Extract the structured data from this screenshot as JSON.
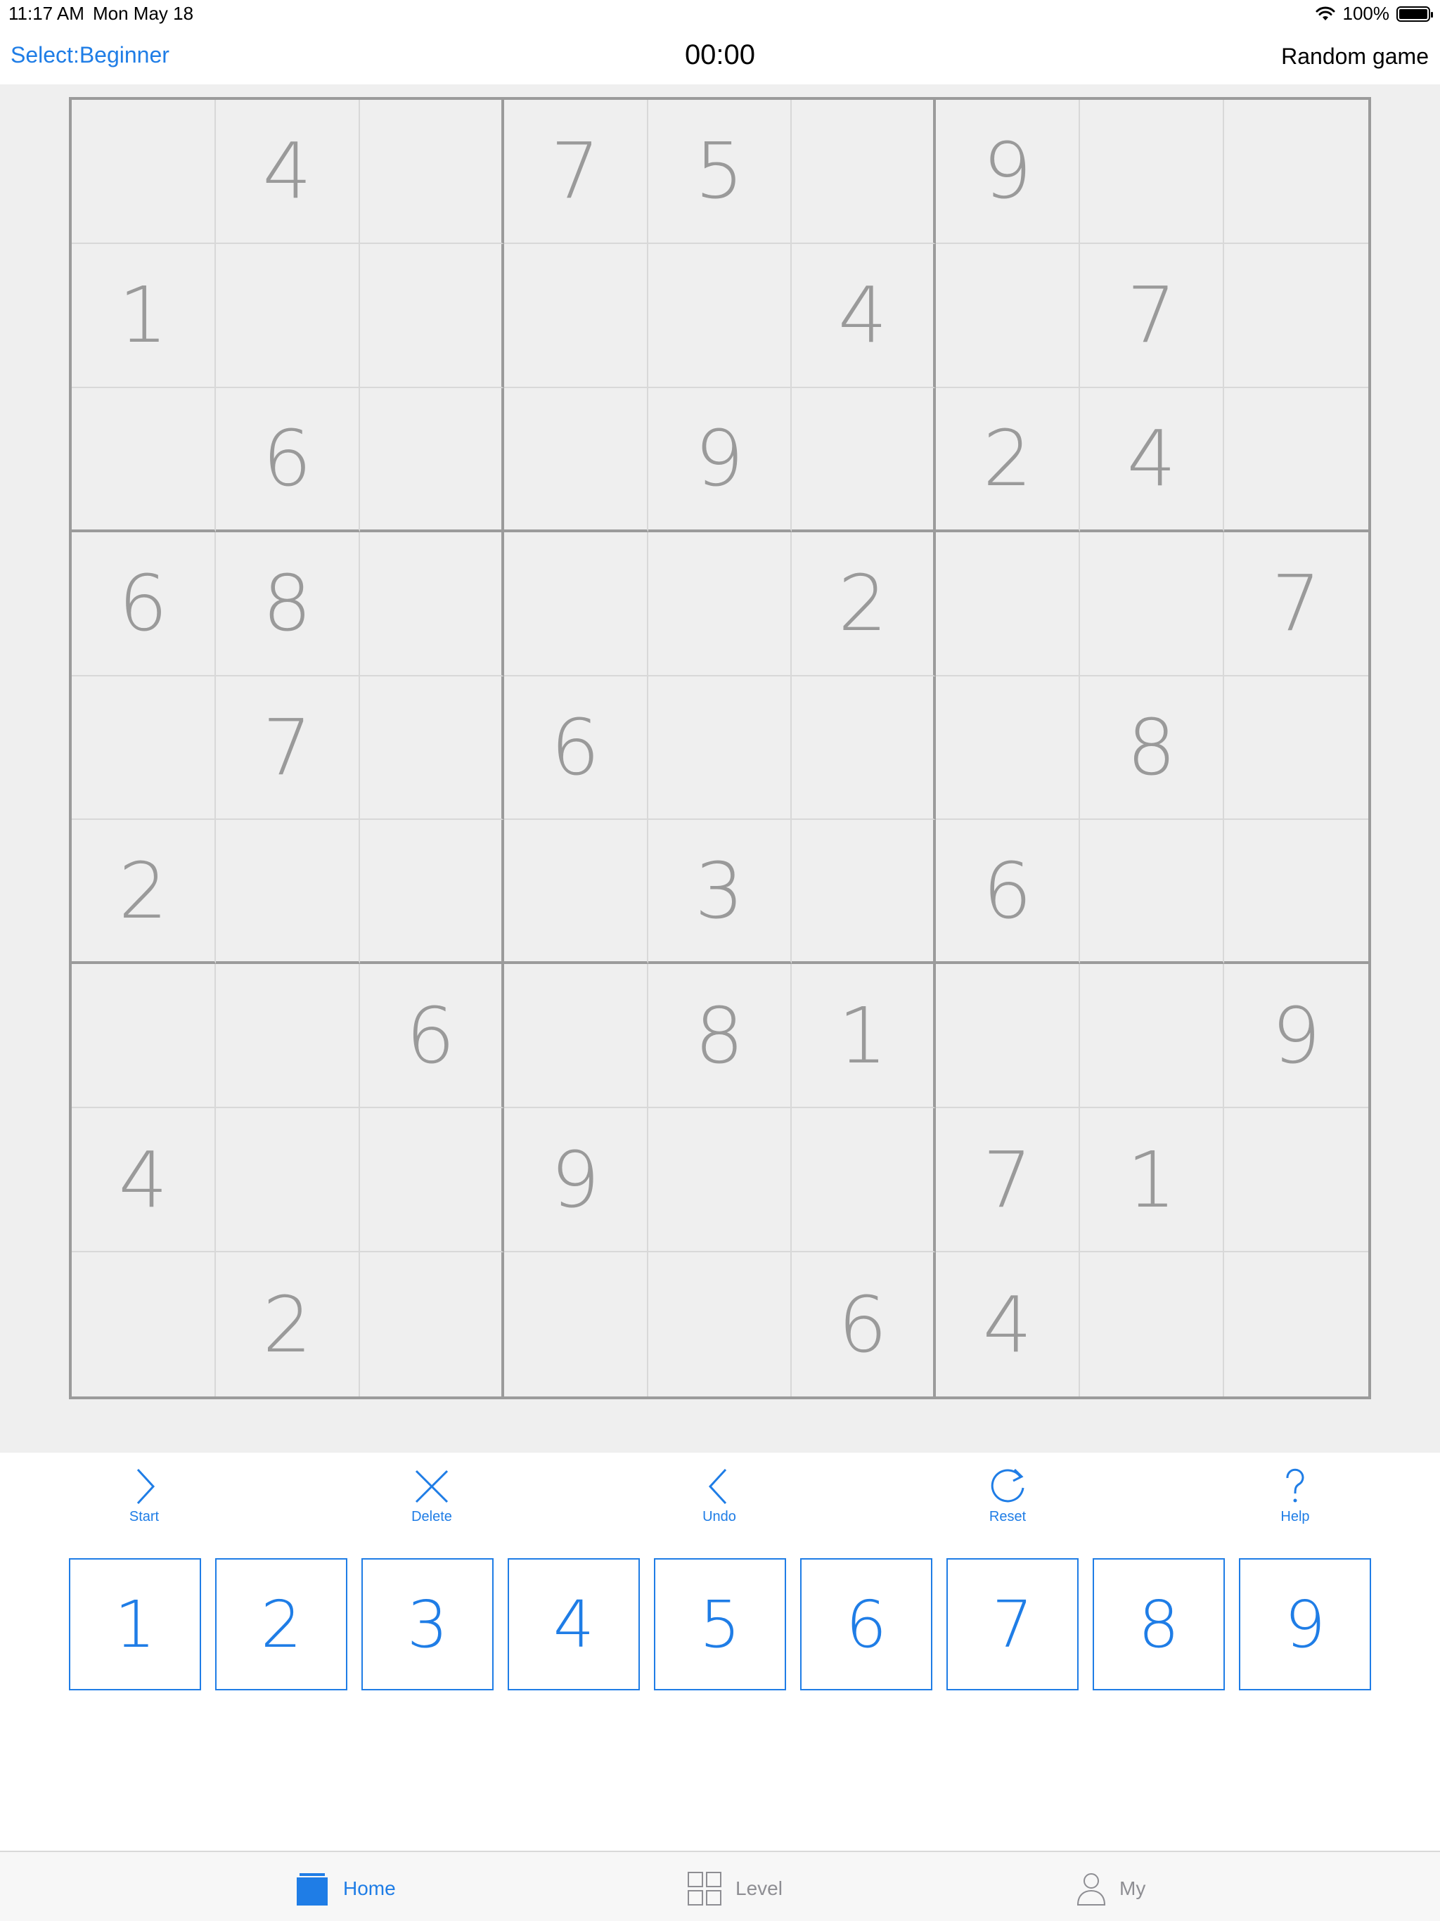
{
  "status_bar": {
    "time": "11:17 AM",
    "date": "Mon May 18",
    "battery": "100%"
  },
  "nav": {
    "select_level": "Select:Beginner",
    "timer": "00:00",
    "random_game": "Random game"
  },
  "board": {
    "rows": [
      [
        "",
        "4",
        "",
        "7",
        "5",
        "",
        "9",
        "",
        ""
      ],
      [
        "1",
        "",
        "",
        "",
        "",
        "4",
        "",
        "7",
        ""
      ],
      [
        "",
        "6",
        "",
        "",
        "9",
        "",
        "2",
        "4",
        ""
      ],
      [
        "6",
        "8",
        "",
        "",
        "",
        "2",
        "",
        "",
        "7"
      ],
      [
        "",
        "7",
        "",
        "6",
        "",
        "",
        "",
        "8",
        ""
      ],
      [
        "2",
        "",
        "",
        "",
        "3",
        "",
        "6",
        "",
        ""
      ],
      [
        "",
        "",
        "6",
        "",
        "8",
        "1",
        "",
        "",
        "9"
      ],
      [
        "4",
        "",
        "",
        "9",
        "",
        "",
        "7",
        "1",
        ""
      ],
      [
        "",
        "2",
        "",
        "",
        "",
        "6",
        "4",
        "",
        ""
      ]
    ]
  },
  "toolbar": {
    "start": "Start",
    "delete": "Delete",
    "undo": "Undo",
    "reset": "Reset",
    "help": "Help"
  },
  "numpad": [
    "1",
    "2",
    "3",
    "4",
    "5",
    "6",
    "7",
    "8",
    "9"
  ],
  "tabs": {
    "home": "Home",
    "level": "Level",
    "my": "My"
  },
  "colors": {
    "accent": "#1f7de6",
    "board_bg": "#efefef",
    "given_digit": "#9a9a9a",
    "inactive_tab": "#8e8e93"
  },
  "icons": {
    "start": "chevron-right-icon",
    "delete": "close-icon",
    "undo": "chevron-left-icon",
    "reset": "refresh-icon",
    "help": "question-icon",
    "home": "home-icon",
    "level": "grid-icon",
    "my": "person-icon"
  }
}
